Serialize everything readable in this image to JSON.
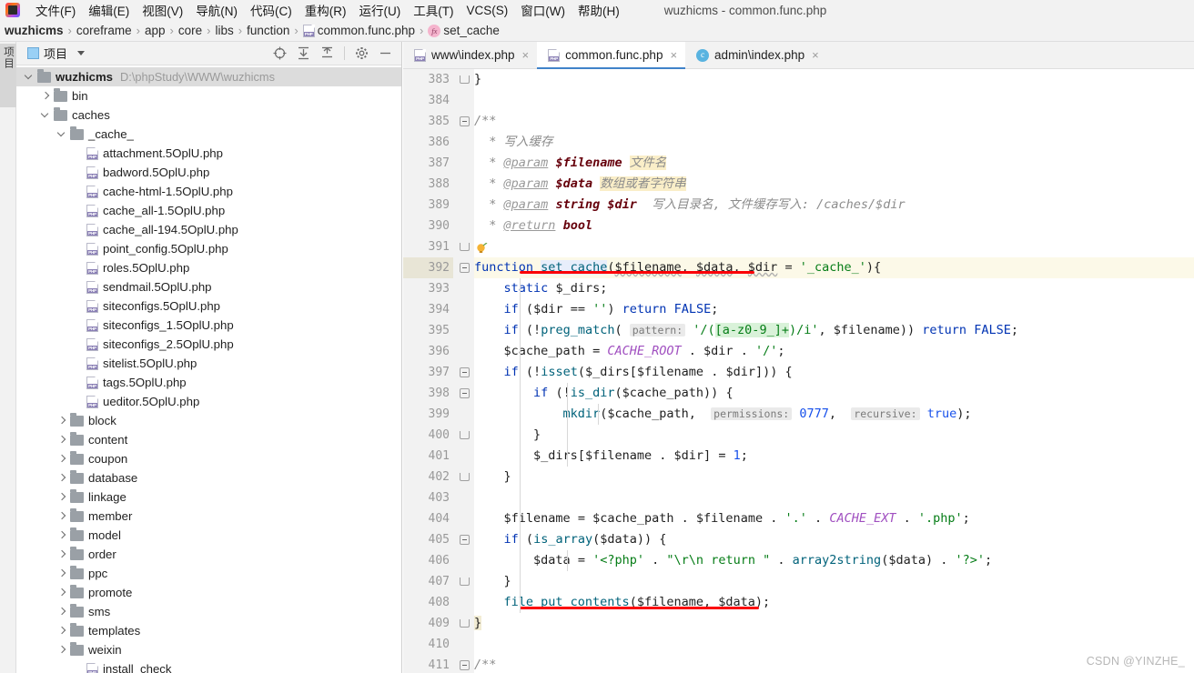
{
  "window": {
    "title": "wuzhicms - common.func.php",
    "logo_icon": "phpstorm-logo-icon"
  },
  "menubar": {
    "items": [
      {
        "label": "文件(F)",
        "mnemonic": "F"
      },
      {
        "label": "编辑(E)",
        "mnemonic": "E"
      },
      {
        "label": "视图(V)",
        "mnemonic": "V"
      },
      {
        "label": "导航(N)",
        "mnemonic": "N"
      },
      {
        "label": "代码(C)",
        "mnemonic": "C"
      },
      {
        "label": "重构(R)",
        "mnemonic": "R"
      },
      {
        "label": "运行(U)",
        "mnemonic": "U"
      },
      {
        "label": "工具(T)",
        "mnemonic": "T"
      },
      {
        "label": "VCS(S)",
        "mnemonic": "S"
      },
      {
        "label": "窗口(W)",
        "mnemonic": "W"
      },
      {
        "label": "帮助(H)",
        "mnemonic": "H"
      }
    ]
  },
  "breadcrumb": {
    "separator": "›",
    "items": [
      {
        "label": "wuzhicms",
        "bold": true,
        "icon": ""
      },
      {
        "label": "coreframe",
        "bold": false,
        "icon": ""
      },
      {
        "label": "app",
        "bold": false,
        "icon": ""
      },
      {
        "label": "core",
        "bold": false,
        "icon": ""
      },
      {
        "label": "libs",
        "bold": false,
        "icon": ""
      },
      {
        "label": "function",
        "bold": false,
        "icon": ""
      },
      {
        "label": "common.func.php",
        "bold": false,
        "icon": "php-file-icon"
      },
      {
        "label": "set_cache",
        "bold": false,
        "icon": "function-symbol-icon"
      }
    ]
  },
  "left_strip": {
    "vertical_tab_label": "项目"
  },
  "project_panel": {
    "title": "项目",
    "tools": [
      {
        "name": "locate-in-tree-icon",
        "glyph": "⊕"
      },
      {
        "name": "expand-all-icon",
        "glyph": "⤓"
      },
      {
        "name": "collapse-all-icon",
        "glyph": "⤒"
      },
      {
        "name": "settings-gear-icon",
        "glyph": "⚙"
      },
      {
        "name": "hide-panel-icon",
        "glyph": "—"
      }
    ],
    "tree": [
      {
        "label": "wuzhicms",
        "path": "D:\\phpStudy\\WWW\\wuzhicms",
        "depth": 0,
        "kind": "folder",
        "state": "expanded",
        "bold": true,
        "selected": true
      },
      {
        "label": "bin",
        "path": "",
        "depth": 1,
        "kind": "folder",
        "state": "collapsed",
        "bold": false,
        "selected": false
      },
      {
        "label": "caches",
        "path": "",
        "depth": 1,
        "kind": "folder",
        "state": "expanded",
        "bold": false,
        "selected": false
      },
      {
        "label": "_cache_",
        "path": "",
        "depth": 2,
        "kind": "folder",
        "state": "expanded",
        "bold": false,
        "selected": false
      },
      {
        "label": "attachment.5OplU.php",
        "path": "",
        "depth": 3,
        "kind": "php",
        "state": "none",
        "bold": false,
        "selected": false
      },
      {
        "label": "badword.5OplU.php",
        "path": "",
        "depth": 3,
        "kind": "php",
        "state": "none",
        "bold": false,
        "selected": false
      },
      {
        "label": "cache-html-1.5OplU.php",
        "path": "",
        "depth": 3,
        "kind": "php",
        "state": "none",
        "bold": false,
        "selected": false
      },
      {
        "label": "cache_all-1.5OplU.php",
        "path": "",
        "depth": 3,
        "kind": "php",
        "state": "none",
        "bold": false,
        "selected": false
      },
      {
        "label": "cache_all-194.5OplU.php",
        "path": "",
        "depth": 3,
        "kind": "php",
        "state": "none",
        "bold": false,
        "selected": false
      },
      {
        "label": "point_config.5OplU.php",
        "path": "",
        "depth": 3,
        "kind": "php",
        "state": "none",
        "bold": false,
        "selected": false
      },
      {
        "label": "roles.5OplU.php",
        "path": "",
        "depth": 3,
        "kind": "php",
        "state": "none",
        "bold": false,
        "selected": false
      },
      {
        "label": "sendmail.5OplU.php",
        "path": "",
        "depth": 3,
        "kind": "php",
        "state": "none",
        "bold": false,
        "selected": false
      },
      {
        "label": "siteconfigs.5OplU.php",
        "path": "",
        "depth": 3,
        "kind": "php",
        "state": "none",
        "bold": false,
        "selected": false
      },
      {
        "label": "siteconfigs_1.5OplU.php",
        "path": "",
        "depth": 3,
        "kind": "php",
        "state": "none",
        "bold": false,
        "selected": false
      },
      {
        "label": "siteconfigs_2.5OplU.php",
        "path": "",
        "depth": 3,
        "kind": "php",
        "state": "none",
        "bold": false,
        "selected": false
      },
      {
        "label": "sitelist.5OplU.php",
        "path": "",
        "depth": 3,
        "kind": "php",
        "state": "none",
        "bold": false,
        "selected": false
      },
      {
        "label": "tags.5OplU.php",
        "path": "",
        "depth": 3,
        "kind": "php",
        "state": "none",
        "bold": false,
        "selected": false
      },
      {
        "label": "ueditor.5OplU.php",
        "path": "",
        "depth": 3,
        "kind": "php",
        "state": "none",
        "bold": false,
        "selected": false
      },
      {
        "label": "block",
        "path": "",
        "depth": 2,
        "kind": "folder",
        "state": "collapsed",
        "bold": false,
        "selected": false
      },
      {
        "label": "content",
        "path": "",
        "depth": 2,
        "kind": "folder",
        "state": "collapsed",
        "bold": false,
        "selected": false
      },
      {
        "label": "coupon",
        "path": "",
        "depth": 2,
        "kind": "folder",
        "state": "collapsed",
        "bold": false,
        "selected": false
      },
      {
        "label": "database",
        "path": "",
        "depth": 2,
        "kind": "folder",
        "state": "collapsed",
        "bold": false,
        "selected": false
      },
      {
        "label": "linkage",
        "path": "",
        "depth": 2,
        "kind": "folder",
        "state": "collapsed",
        "bold": false,
        "selected": false
      },
      {
        "label": "member",
        "path": "",
        "depth": 2,
        "kind": "folder",
        "state": "collapsed",
        "bold": false,
        "selected": false
      },
      {
        "label": "model",
        "path": "",
        "depth": 2,
        "kind": "folder",
        "state": "collapsed",
        "bold": false,
        "selected": false
      },
      {
        "label": "order",
        "path": "",
        "depth": 2,
        "kind": "folder",
        "state": "collapsed",
        "bold": false,
        "selected": false
      },
      {
        "label": "ppc",
        "path": "",
        "depth": 2,
        "kind": "folder",
        "state": "collapsed",
        "bold": false,
        "selected": false
      },
      {
        "label": "promote",
        "path": "",
        "depth": 2,
        "kind": "folder",
        "state": "collapsed",
        "bold": false,
        "selected": false
      },
      {
        "label": "sms",
        "path": "",
        "depth": 2,
        "kind": "folder",
        "state": "collapsed",
        "bold": false,
        "selected": false
      },
      {
        "label": "templates",
        "path": "",
        "depth": 2,
        "kind": "folder",
        "state": "collapsed",
        "bold": false,
        "selected": false
      },
      {
        "label": "weixin",
        "path": "",
        "depth": 2,
        "kind": "folder",
        "state": "collapsed",
        "bold": false,
        "selected": false
      },
      {
        "label": "install_check",
        "path": "",
        "depth": 3,
        "kind": "php",
        "state": "none",
        "bold": false,
        "selected": false
      }
    ]
  },
  "editor_tabs": [
    {
      "label": "www\\index.php",
      "icon": "php-file-icon",
      "active": false,
      "close": "×"
    },
    {
      "label": "common.func.php",
      "icon": "php-file-icon",
      "active": true,
      "close": "×"
    },
    {
      "label": "admin\\index.php",
      "icon": "class-file-icon",
      "active": false,
      "close": "×"
    }
  ],
  "editor": {
    "first_line_number": 383,
    "lines": [
      {
        "n": 383,
        "fold": "end",
        "highlight": false,
        "text": "}"
      },
      {
        "n": 384,
        "fold": "",
        "highlight": false,
        "text": ""
      },
      {
        "n": 385,
        "fold": "start",
        "highlight": false,
        "text": "/**"
      },
      {
        "n": 386,
        "fold": "",
        "highlight": false,
        "text": " * 写入缓存"
      },
      {
        "n": 387,
        "fold": "",
        "highlight": false,
        "text": " * @param $filename 文件名"
      },
      {
        "n": 388,
        "fold": "",
        "highlight": false,
        "text": " * @param $data 数组或者字符串"
      },
      {
        "n": 389,
        "fold": "",
        "highlight": false,
        "text": " * @param string $dir 写入目录名, 文件缓存写入: /caches/$dir"
      },
      {
        "n": 390,
        "fold": "",
        "highlight": false,
        "text": " * @return bool"
      },
      {
        "n": 391,
        "fold": "end",
        "highlight": false,
        "text": " (intention bulb)"
      },
      {
        "n": 392,
        "fold": "start",
        "highlight": true,
        "text": "function set_cache($filename, $data, $dir = '_cache_'){"
      },
      {
        "n": 393,
        "fold": "",
        "highlight": false,
        "text": "    static $_dirs;"
      },
      {
        "n": 394,
        "fold": "",
        "highlight": false,
        "text": "    if ($dir == '') return FALSE;"
      },
      {
        "n": 395,
        "fold": "",
        "highlight": false,
        "text": "    if (!preg_match( pattern: '/([a-z0-9_]+)/i', $filename)) return FALSE;"
      },
      {
        "n": 396,
        "fold": "",
        "highlight": false,
        "text": "    $cache_path = CACHE_ROOT . $dir . '/';"
      },
      {
        "n": 397,
        "fold": "start",
        "highlight": false,
        "text": "    if (!isset($_dirs[$filename . $dir])) {"
      },
      {
        "n": 398,
        "fold": "start",
        "highlight": false,
        "text": "        if (!is_dir($cache_path)) {"
      },
      {
        "n": 399,
        "fold": "",
        "highlight": false,
        "text": "            mkdir($cache_path,  permissions: 0777,  recursive: true);"
      },
      {
        "n": 400,
        "fold": "end",
        "highlight": false,
        "text": "        }"
      },
      {
        "n": 401,
        "fold": "",
        "highlight": false,
        "text": "        $_dirs[$filename . $dir] = 1;"
      },
      {
        "n": 402,
        "fold": "end",
        "highlight": false,
        "text": "    }"
      },
      {
        "n": 403,
        "fold": "",
        "highlight": false,
        "text": ""
      },
      {
        "n": 404,
        "fold": "",
        "highlight": false,
        "text": "    $filename = $cache_path . $filename . '.' . CACHE_EXT . '.php';"
      },
      {
        "n": 405,
        "fold": "start",
        "highlight": false,
        "text": "    if (is_array($data)) {"
      },
      {
        "n": 406,
        "fold": "",
        "highlight": false,
        "text": "        $data = '<?php' . \"\\r\\n return \" . array2string($data) . '?>';"
      },
      {
        "n": 407,
        "fold": "end",
        "highlight": false,
        "text": "    }"
      },
      {
        "n": 408,
        "fold": "",
        "highlight": false,
        "text": "    file_put_contents($filename, $data);"
      },
      {
        "n": 409,
        "fold": "end",
        "highlight": false,
        "text": "}"
      },
      {
        "n": 410,
        "fold": "",
        "highlight": false,
        "text": ""
      },
      {
        "n": 411,
        "fold": "start",
        "highlight": false,
        "text": "/**"
      }
    ],
    "annotations": [
      {
        "name": "red-underline-set-cache-signature",
        "color": "#fb0007"
      },
      {
        "name": "red-underline-file-put-contents",
        "color": "#fb0007"
      }
    ]
  },
  "watermark": {
    "text": "CSDN @YINZHE_"
  },
  "colors": {
    "accent": "#4083c9",
    "annotation_red": "#fb0007",
    "current_line": "#fcf9e8",
    "doc_highlight": "#faeec8",
    "panel_bg": "#f2f2f2"
  }
}
